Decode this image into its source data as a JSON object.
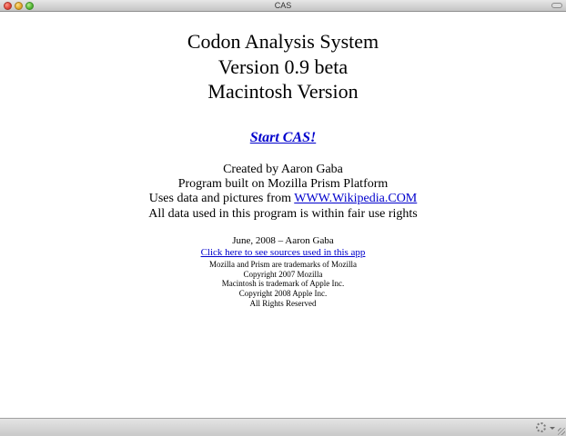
{
  "window": {
    "title": "CAS"
  },
  "heading": {
    "line1": "Codon Analysis System",
    "line2": "Version 0.9 beta",
    "line3": "Macintosh Version"
  },
  "start_link": "Start CAS!",
  "credits": {
    "created_by": "Created by Aaron Gaba",
    "built_on": "Program built on Mozilla Prism Platform",
    "uses_data_prefix": "Uses data and pictures from ",
    "wikipedia_link": "WWW.Wikipedia.COM",
    "fair_use": "All data used in this program is within fair use rights"
  },
  "footer": {
    "date_author": "June, 2008 – Aaron Gaba",
    "sources_link": "Click here to see sources used in this app",
    "lines": [
      "Mozilla and Prism are trademarks of Mozilla",
      "Copyright 2007 Mozilla",
      "Macintosh is trademark of Apple Inc.",
      "Copyright 2008 Apple Inc.",
      "All Rights Reserved"
    ]
  },
  "icons": {
    "close": "close-icon",
    "minimize": "minimize-icon",
    "zoom": "zoom-icon",
    "toolbar": "toolbar-toggle-icon",
    "gear": "gear-icon",
    "resize": "resize-grip-icon"
  },
  "colors": {
    "link": "#0000cc",
    "background": "#ffffff"
  }
}
